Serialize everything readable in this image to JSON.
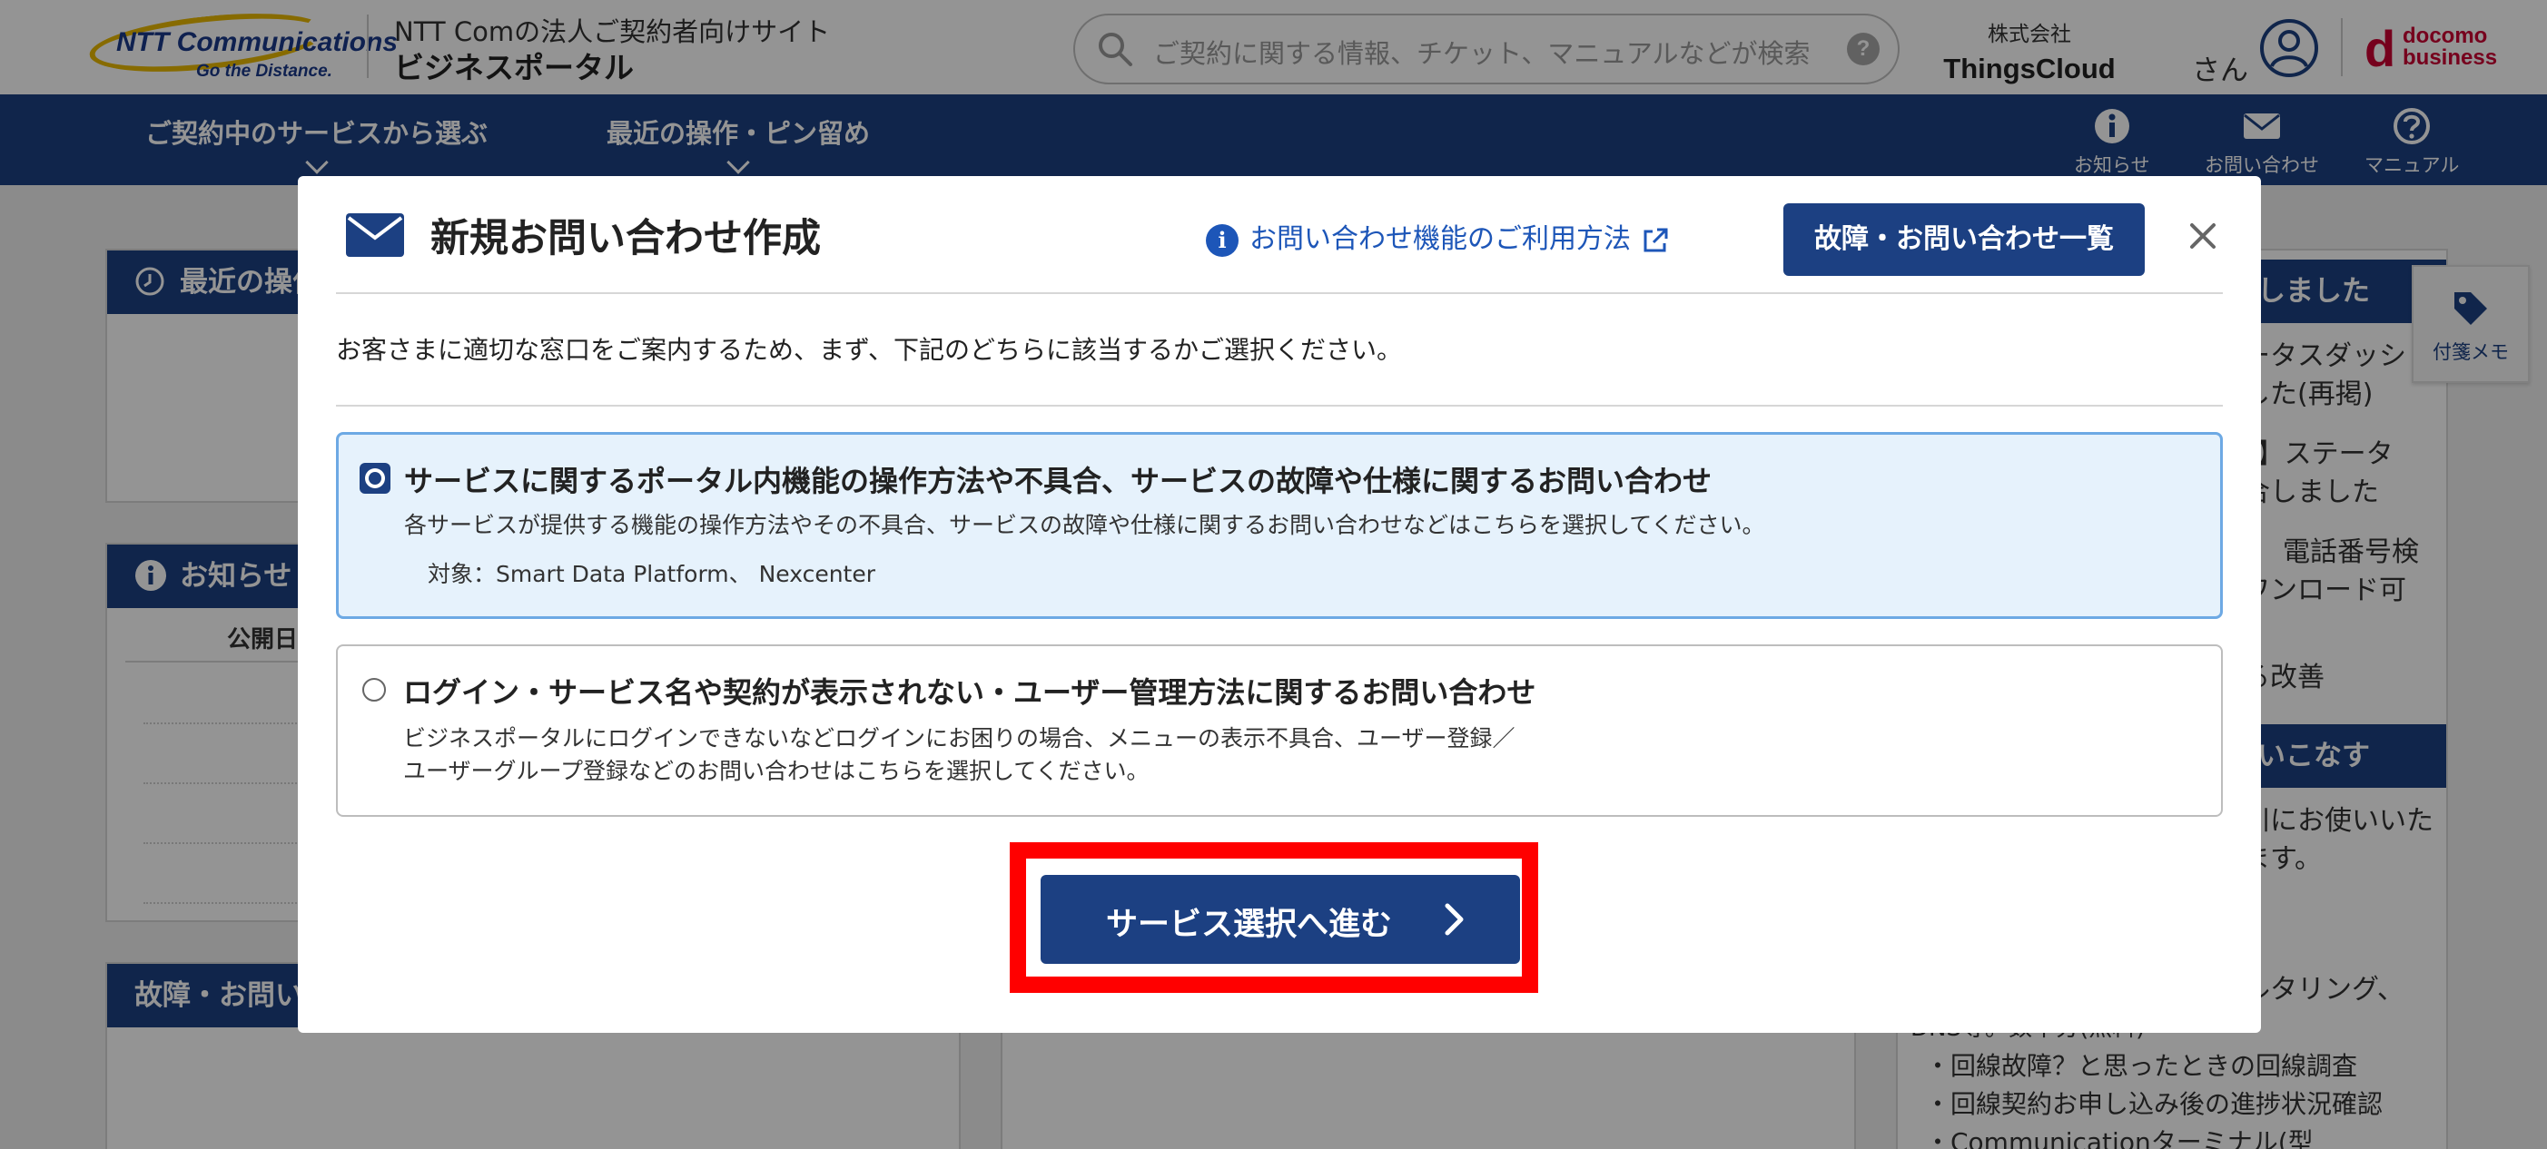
{
  "header": {
    "logo_brand": "NTT Communications",
    "logo_tagline": "Go the Distance.",
    "site_subtitle": "NTT Comの法人ご契約者向けサイト",
    "site_title": "ビジネスポータル",
    "search_placeholder": "ご契約に関する情報、チケット、マニュアルなどが検索",
    "search_help": "?",
    "company_type": "株式会社",
    "company_name": "ThingsCloud",
    "honorific": "さん",
    "docomo_line1": "docomo",
    "docomo_line2": "business"
  },
  "nav": {
    "items": [
      "ご契約中のサービスから選ぶ",
      "最近の操作・ピン留め"
    ],
    "utilities": [
      "お知らせ",
      "お問い合わせ",
      "マニュアル"
    ]
  },
  "background": {
    "panel1_title": "最近の操作",
    "panel2_title": "お知らせ",
    "panel2_col": "公開日",
    "panel3_title": "故障・お問い合わせ",
    "right_head1": "しました",
    "right_lines1": [
      "ータスダッシ",
      "した(再掲)",
      "s】ステータ",
      "合しました",
      "電話番号検",
      "ワンロード可",
      "る改善"
    ],
    "right_head2": "いこなす",
    "right_lines2": [
      "川にお使いいた",
      "ます。"
    ],
    "right_lines3": [
      "ルタリング、",
      "DNS等。数十分(無料)",
      "・回線故障？と思ったときの回線調査",
      "・回線契約お申し込み後の進捗状況確認",
      "・Communicationターミナル(型"
    ],
    "memo_label": "付箋メモ"
  },
  "modal": {
    "title": "新規お問い合わせ作成",
    "help_link": "お問い合わせ機能のご利用方法",
    "list_button": "故障・お問い合わせ一覧",
    "intro": "お客さまに適切な窓口をご案内するため、まず、下記のどちらに該当するかご選択ください。",
    "options": [
      {
        "title": "サービスに関するポータル内機能の操作方法や不具合、サービスの故障や仕様に関するお問い合わせ",
        "desc1": "各サービスが提供する機能の操作方法やその不具合、サービスの故障や仕様に関するお問い合わせなどはこちらを選択してください。",
        "desc2": "対象：Smart Data Platform、 Nexcenter",
        "selected": true
      },
      {
        "title": "ログイン・サービス名や契約が表示されない・ユーザー管理方法に関するお問い合わせ",
        "desc1": "ビジネスポータルにログインできないなどログインにお困りの場合、メニューの表示不具合、ユーザー登録／",
        "desc2": "ユーザーグループ登録などのお問い合わせはこちらを選択してください。",
        "selected": false
      }
    ],
    "proceed_button": "サービス選択へ進む"
  },
  "colors": {
    "brand_navy": "#1c4082",
    "link_blue": "#1d56b8",
    "selected_bg": "#e6f2fc",
    "selected_border": "#6da9e4",
    "highlight_red": "#ff0000",
    "docomo_red": "#cc0033"
  },
  "icons": [
    "search-icon",
    "help-circle-icon",
    "user-avatar-icon",
    "info-icon",
    "mail-icon",
    "question-icon",
    "clock-icon",
    "tag-icon",
    "external-link-icon",
    "close-icon",
    "chevron-right-icon",
    "chevron-down-icon"
  ]
}
